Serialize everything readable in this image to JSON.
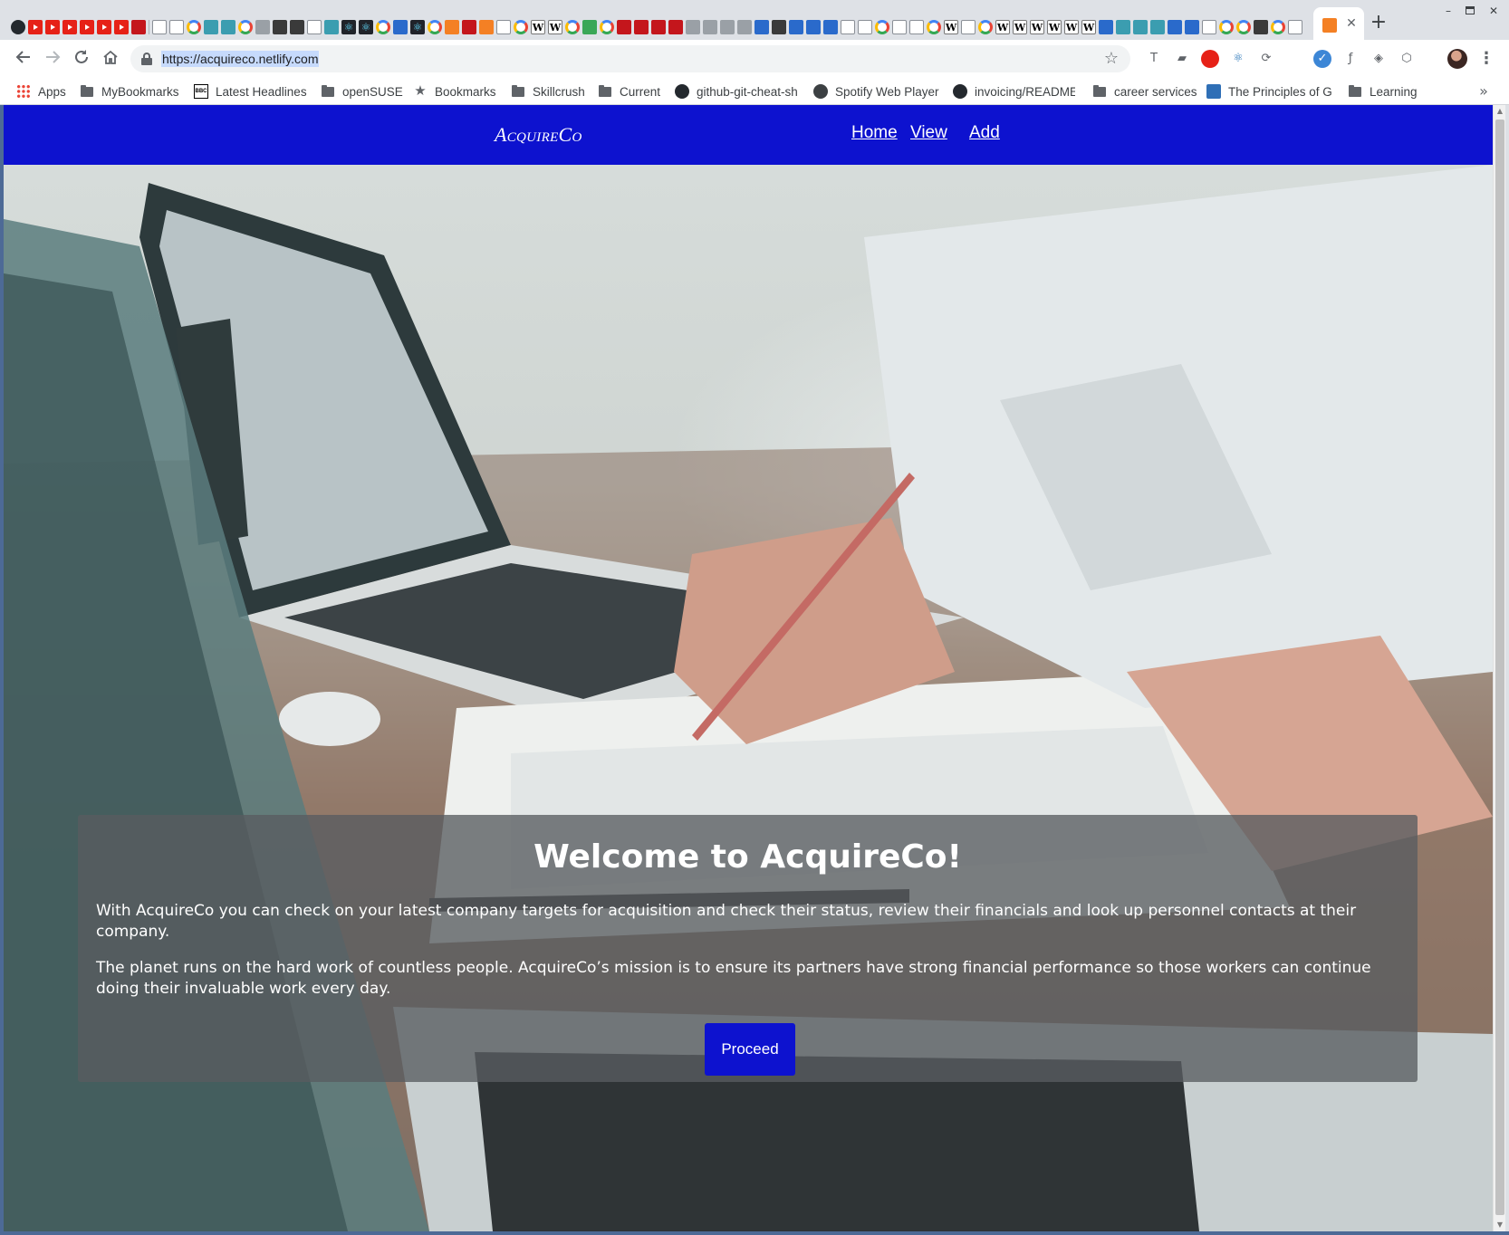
{
  "browser": {
    "url": "https://acquireco.netlify.com",
    "new_tab_symbol": "+",
    "tab_close_symbol": "✕",
    "window_controls": {
      "minimize": "–",
      "maximize": "□",
      "close": "✕"
    },
    "pinned_tab_icons": [
      "github-icon",
      "youtube-icon",
      "youtube-icon",
      "youtube-icon",
      "youtube-icon",
      "youtube-icon",
      "youtube-icon",
      "udemy-icon",
      "document-icon",
      "document-icon",
      "google-icon",
      "terminal-icon",
      "terminal-icon",
      "google-icon",
      "document-icon",
      "react-icon",
      "react-icon",
      "google-icon",
      "react-icon",
      "react-icon",
      "google-icon",
      "stackoverflow-icon",
      "wikipedia-icon",
      "wikipedia-icon",
      "google-icon",
      "wikipedia-icon",
      "google-icon"
    ],
    "extensions": [
      "text-format-icon",
      "chat-icon",
      "youtube-icon",
      "react-devtools-icon",
      "sync-icon",
      "functions-icon",
      "puzzle-icon",
      "shield-icon"
    ]
  },
  "bookmarks": [
    {
      "label": "Apps",
      "icon": "apps-icon"
    },
    {
      "label": "MyBookmarks",
      "icon": "folder-icon"
    },
    {
      "label": "Latest Headlines",
      "icon": "bbc-icon"
    },
    {
      "label": "openSUSE",
      "icon": "folder-icon"
    },
    {
      "label": "Bookmarks",
      "icon": "star-icon"
    },
    {
      "label": "Skillcrush",
      "icon": "folder-icon"
    },
    {
      "label": "Current",
      "icon": "folder-icon"
    },
    {
      "label": "github-git-cheat-sh",
      "icon": "github-icon"
    },
    {
      "label": "Spotify Web Player",
      "icon": "spotify-icon"
    },
    {
      "label": "invoicing/README",
      "icon": "github-icon"
    },
    {
      "label": "career services",
      "icon": "folder-icon"
    },
    {
      "label": "The Principles of G",
      "icon": "site-icon"
    },
    {
      "label": "Learning",
      "icon": "folder-icon"
    }
  ],
  "site": {
    "brand": "AcquireCo",
    "nav": {
      "home": "Home",
      "view": "View",
      "add": "Add"
    },
    "hero": {
      "title": "Welcome to AcquireCo!",
      "paragraph_1": "With AcquireCo you can check on your latest company targets for acquisition and check their status, review their financials and look up personnel contacts at their company.",
      "paragraph_2": "The planet runs on the hard work of countless people. AcquireCo’s mission is to ensure its partners have strong financial performance so those workers can continue doing their invaluable work every day.",
      "button": "Proceed"
    },
    "colors": {
      "nav_bg": "#0d12cf",
      "button_bg": "#0d12cf",
      "card_bg": "rgba(88,92,96,0.78)"
    }
  }
}
